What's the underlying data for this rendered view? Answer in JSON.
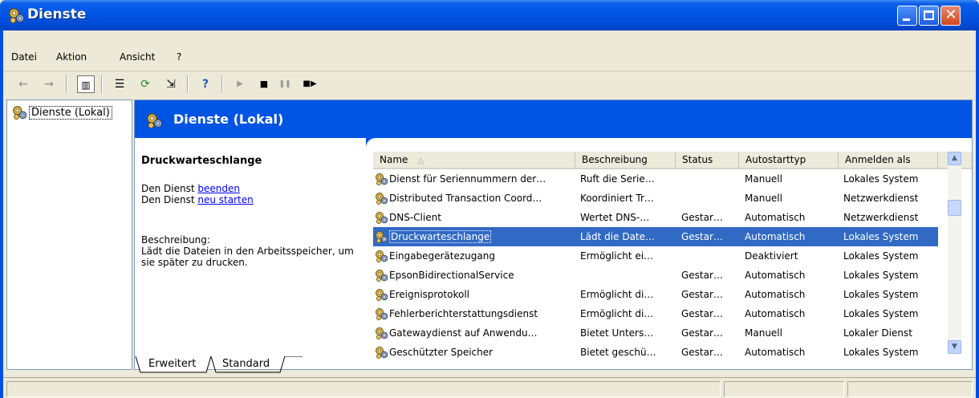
{
  "window": {
    "title": "Dienste",
    "icon": "services-gear-icon"
  },
  "menu": [
    {
      "label": "Datei",
      "x": 0
    },
    {
      "label": "Aktion",
      "x": 1
    },
    {
      "label": "Ansicht",
      "x": 2
    },
    {
      "label": "?",
      "x": 3
    }
  ],
  "toolbar": {
    "back": "←",
    "forward": "→",
    "console_tree": "▥",
    "properties": "☰",
    "refresh": "⟳",
    "export": "⇲",
    "help": "?",
    "play": "▶",
    "stop": "■",
    "pause": "❚❚",
    "restart": "■▶"
  },
  "tree": {
    "root_label": "Dienste (Lokal)"
  },
  "header": {
    "title": "Dienste (Lokal)"
  },
  "details": {
    "service_name": "Druckwarteschlange",
    "line1_prefix": "Den Dienst",
    "line1_link": "beenden",
    "line2_prefix": "Den Dienst",
    "line2_link": "neu starten",
    "desc_label": "Beschreibung:",
    "desc_text": "Lädt die Dateien in den Arbeitsspeicher, um sie später zu drucken."
  },
  "columns": [
    "Name",
    "Beschreibung",
    "Status",
    "Autostarttyp",
    "Anmelden als"
  ],
  "rows": [
    {
      "name": "Dienst für Seriennummern der…",
      "desc": "Ruft die Serie…",
      "status": "",
      "start": "Manuell",
      "logon": "Lokales System"
    },
    {
      "name": "Distributed Transaction Coord…",
      "desc": "Koordiniert Tr…",
      "status": "",
      "start": "Manuell",
      "logon": "Netzwerkdienst"
    },
    {
      "name": "DNS-Client",
      "desc": "Wertet DNS-…",
      "status": "Gestar…",
      "start": "Automatisch",
      "logon": "Netzwerkdienst"
    },
    {
      "name": "Druckwarteschlange",
      "desc": "Lädt die Date…",
      "status": "Gestar…",
      "start": "Automatisch",
      "logon": "Lokales System"
    },
    {
      "name": "Eingabegerätezugang",
      "desc": "Ermöglicht ei…",
      "status": "",
      "start": "Deaktiviert",
      "logon": "Lokales System"
    },
    {
      "name": "EpsonBidirectionalService",
      "desc": "",
      "status": "Gestar…",
      "start": "Automatisch",
      "logon": "Lokales System"
    },
    {
      "name": "Ereignisprotokoll",
      "desc": "Ermöglicht di…",
      "status": "Gestar…",
      "start": "Automatisch",
      "logon": "Lokales System"
    },
    {
      "name": "Fehlerberichterstattungsdienst",
      "desc": "Ermöglicht di…",
      "status": "Gestar…",
      "start": "Automatisch",
      "logon": "Lokales System"
    },
    {
      "name": "Gatewaydienst auf Anwendu…",
      "desc": "Bietet Unters…",
      "status": "Gestar…",
      "start": "Manuell",
      "logon": "Lokaler Dienst"
    },
    {
      "name": "Geschützter Speicher",
      "desc": "Bietet geschü…",
      "status": "Gestar…",
      "start": "Automatisch",
      "logon": "Lokales System"
    }
  ],
  "selected_row": 3,
  "tabs": {
    "extended": "Erweitert",
    "standard": "Standard"
  }
}
